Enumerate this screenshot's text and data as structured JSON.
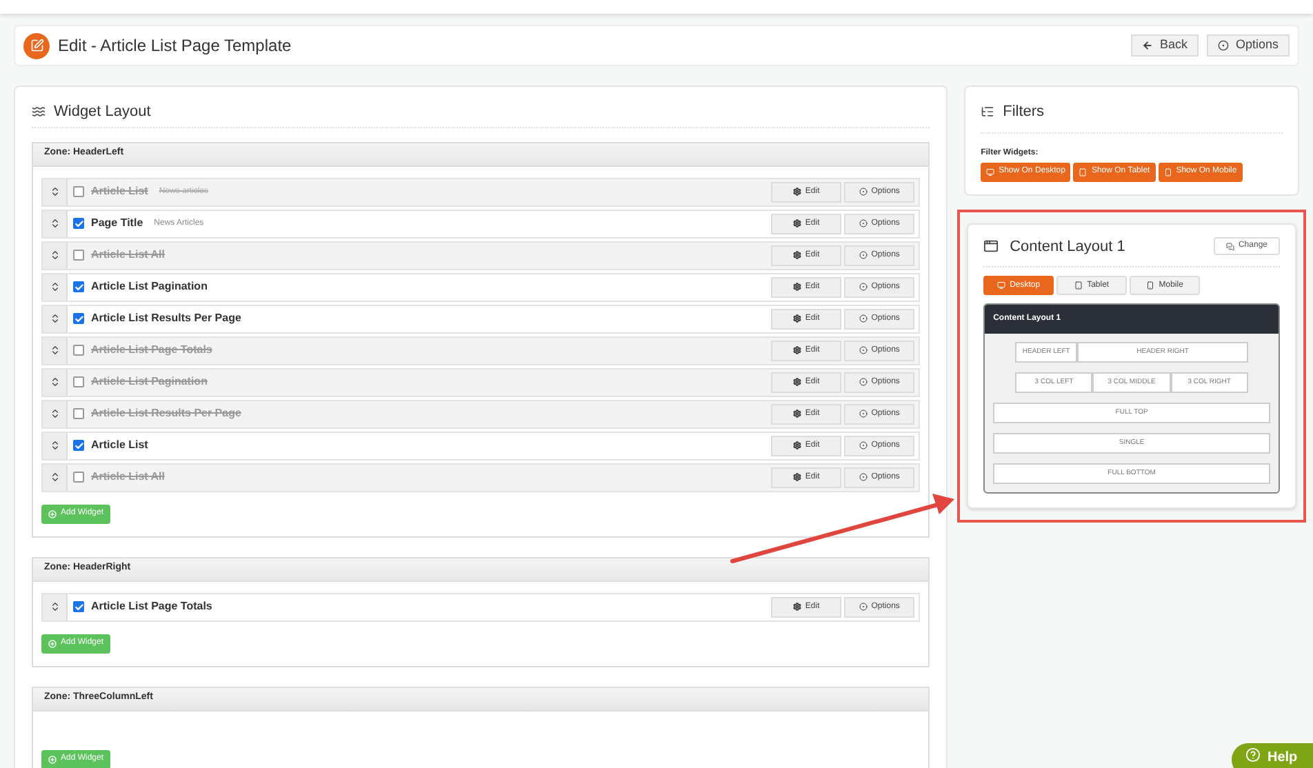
{
  "page_title": "Edit - Article List Page Template",
  "header_buttons": [
    {
      "kind": "back",
      "label": "Back"
    },
    {
      "kind": "options",
      "label": "Options"
    }
  ],
  "widget_layout": {
    "title": "Widget Layout",
    "zones": [
      {
        "title": "Zone: HeaderLeft",
        "add_label": "Add Widget",
        "widgets": [
          {
            "name": "Article List",
            "note": "News articles",
            "checked": false,
            "edit_label": "Edit",
            "options_label": "Options"
          },
          {
            "name": "Page Title",
            "note": "News Articles",
            "checked": true,
            "edit_label": "Edit",
            "options_label": "Options"
          },
          {
            "name": "Article List All",
            "checked": false,
            "edit_label": "Edit",
            "options_label": "Options"
          },
          {
            "name": "Article List Pagination",
            "checked": true,
            "edit_label": "Edit",
            "options_label": "Options"
          },
          {
            "name": "Article List Results Per Page",
            "checked": true,
            "edit_label": "Edit",
            "options_label": "Options"
          },
          {
            "name": "Article List Page Totals",
            "checked": false,
            "edit_label": "Edit",
            "options_label": "Options"
          },
          {
            "name": "Article List Pagination",
            "checked": false,
            "edit_label": "Edit",
            "options_label": "Options"
          },
          {
            "name": "Article List Results Per Page",
            "checked": false,
            "edit_label": "Edit",
            "options_label": "Options"
          },
          {
            "name": "Article List",
            "checked": true,
            "edit_label": "Edit",
            "options_label": "Options"
          },
          {
            "name": "Article List All",
            "checked": false,
            "edit_label": "Edit",
            "options_label": "Options"
          }
        ]
      },
      {
        "title": "Zone: HeaderRight",
        "add_label": "Add Widget",
        "widgets": [
          {
            "name": "Article List Page Totals",
            "checked": true,
            "edit_label": "Edit",
            "options_label": "Options"
          }
        ]
      },
      {
        "title": "Zone: ThreeColumnLeft",
        "add_label": "Add Widget"
      }
    ]
  },
  "filters": {
    "title": "Filters",
    "label": "Filter Widgets:",
    "buttons": [
      {
        "kind": "desktop",
        "label": "Show On Desktop"
      },
      {
        "kind": "tablet",
        "label": "Show On Tablet"
      },
      {
        "kind": "mobile",
        "label": "Show On Mobile"
      }
    ]
  },
  "content_layout": {
    "title": "Content Layout 1",
    "change_label": "Change",
    "tabs": [
      {
        "kind": "desktop",
        "label": "Desktop",
        "selected": true
      },
      {
        "kind": "tablet",
        "label": "Tablet",
        "selected": false
      },
      {
        "kind": "mobile",
        "label": "Mobile",
        "selected": false
      }
    ],
    "preview_title": "Content Layout 1",
    "rows": [
      {
        "kind": "narrow",
        "cells": [
          "HEADER LEFT",
          "HEADER RIGHT"
        ]
      },
      {
        "kind": "narrow",
        "cells": [
          "3 COL LEFT",
          "3 COL MIDDLE",
          "3 COL RIGHT"
        ]
      },
      {
        "kind": "full",
        "cells": [
          "FULL TOP"
        ]
      },
      {
        "kind": "full",
        "cells": [
          "SINGLE"
        ]
      },
      {
        "kind": "full",
        "cells": [
          "FULL BOTTOM"
        ]
      }
    ]
  },
  "help_label": "Help"
}
